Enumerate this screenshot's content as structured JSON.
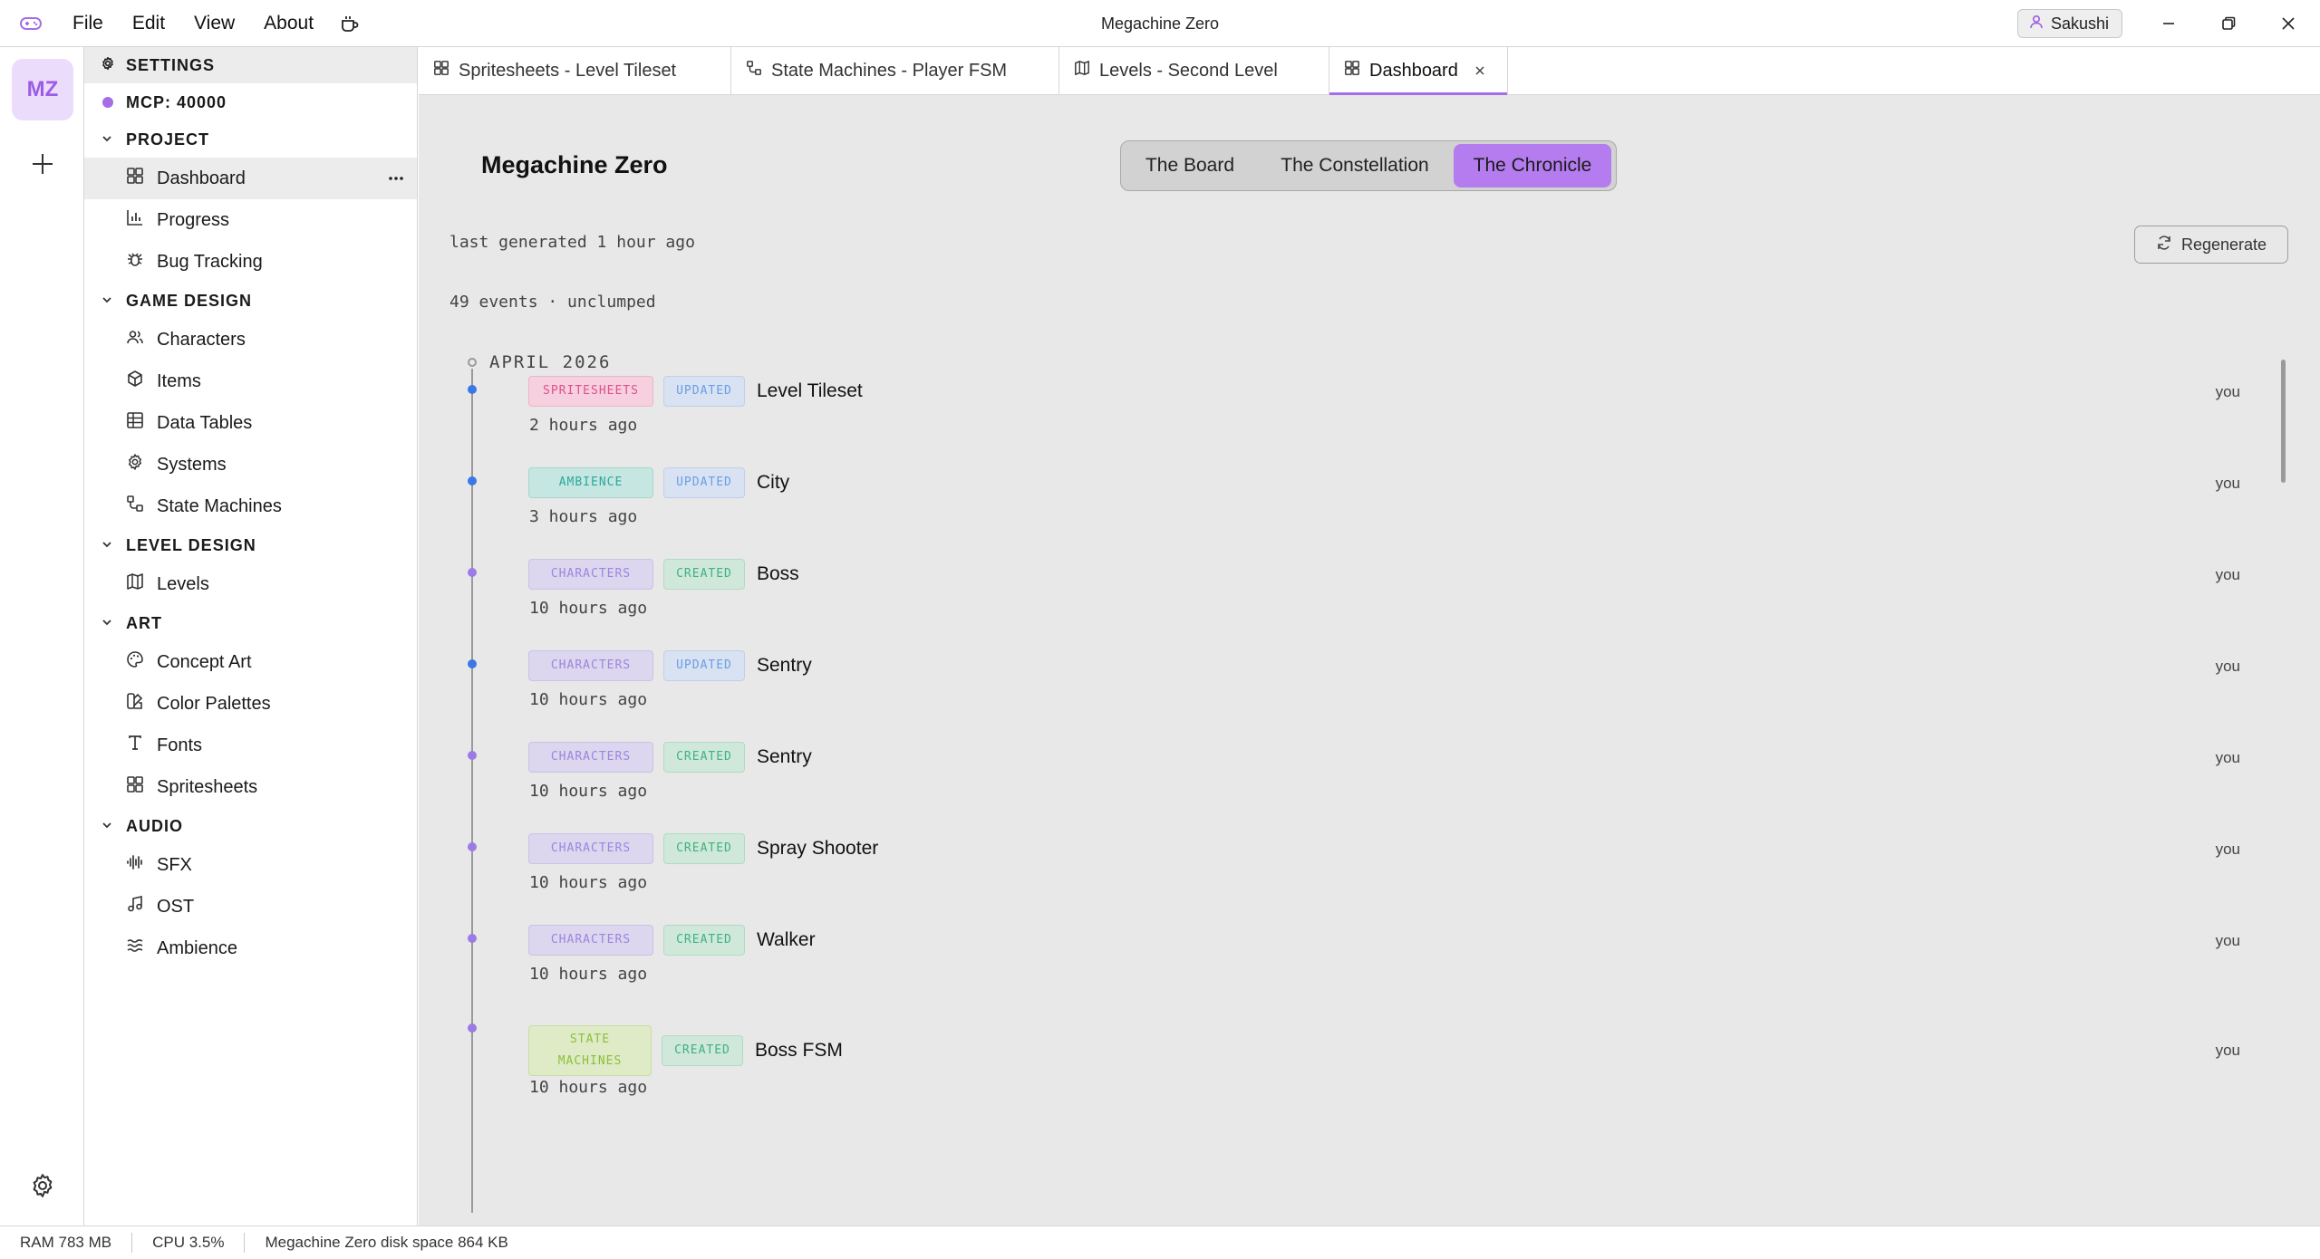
{
  "window": {
    "title": "Megachine Zero"
  },
  "menu": [
    "File",
    "Edit",
    "View",
    "About"
  ],
  "user": {
    "name": "Sakushi"
  },
  "rail": {
    "avatar": "MZ"
  },
  "sidebar": {
    "settings_label": "SETTINGS",
    "mcp_label": "MCP: 40000",
    "sections": [
      {
        "label": "PROJECT",
        "items": [
          {
            "label": "Dashboard",
            "icon": "grid-icon",
            "active": true
          },
          {
            "label": "Progress",
            "icon": "bar-chart-icon"
          },
          {
            "label": "Bug Tracking",
            "icon": "bug-icon"
          }
        ]
      },
      {
        "label": "GAME DESIGN",
        "items": [
          {
            "label": "Characters",
            "icon": "users-icon"
          },
          {
            "label": "Items",
            "icon": "box-icon"
          },
          {
            "label": "Data Tables",
            "icon": "table-icon"
          },
          {
            "label": "Systems",
            "icon": "cog-icon"
          },
          {
            "label": "State Machines",
            "icon": "workflow-icon"
          }
        ]
      },
      {
        "label": "LEVEL DESIGN",
        "items": [
          {
            "label": "Levels",
            "icon": "map-icon"
          }
        ]
      },
      {
        "label": "ART",
        "items": [
          {
            "label": "Concept Art",
            "icon": "palette-icon"
          },
          {
            "label": "Color Palettes",
            "icon": "swatch-icon"
          },
          {
            "label": "Fonts",
            "icon": "type-icon"
          },
          {
            "label": "Spritesheets",
            "icon": "grid-icon"
          }
        ]
      },
      {
        "label": "AUDIO",
        "items": [
          {
            "label": "SFX",
            "icon": "waveform-icon"
          },
          {
            "label": "OST",
            "icon": "music-icon"
          },
          {
            "label": "Ambience",
            "icon": "waves-icon"
          }
        ]
      }
    ]
  },
  "tabs": [
    {
      "label": "Spritesheets - Level Tileset",
      "icon": "grid-icon"
    },
    {
      "label": "State Machines - Player FSM",
      "icon": "workflow-icon"
    },
    {
      "label": "Levels - Second Level",
      "icon": "map-icon"
    },
    {
      "label": "Dashboard",
      "icon": "grid-icon",
      "active": true
    }
  ],
  "main": {
    "project_title": "Megachine Zero",
    "views": [
      {
        "label": "The Board"
      },
      {
        "label": "The Constellation"
      },
      {
        "label": "The Chronicle",
        "active": true
      }
    ],
    "last_generated": "last generated 1 hour ago",
    "regenerate_label": "Regenerate",
    "events_summary": "49 events · unclumped",
    "month": "APRIL 2026",
    "events": [
      {
        "category": "SPRITESHEETS",
        "action": "UPDATED",
        "name": "Level Tileset",
        "time": "2 hours ago",
        "who": "you"
      },
      {
        "category": "AMBIENCE",
        "action": "UPDATED",
        "name": "City",
        "time": "3 hours ago",
        "who": "you"
      },
      {
        "category": "CHARACTERS",
        "action": "CREATED",
        "name": "Boss",
        "time": "10 hours ago",
        "who": "you"
      },
      {
        "category": "CHARACTERS",
        "action": "UPDATED",
        "name": "Sentry",
        "time": "10 hours ago",
        "who": "you"
      },
      {
        "category": "CHARACTERS",
        "action": "CREATED",
        "name": "Sentry",
        "time": "10 hours ago",
        "who": "you"
      },
      {
        "category": "CHARACTERS",
        "action": "CREATED",
        "name": "Spray Shooter",
        "time": "10 hours ago",
        "who": "you"
      },
      {
        "category": "CHARACTERS",
        "action": "CREATED",
        "name": "Walker",
        "time": "10 hours ago",
        "who": "you"
      },
      {
        "category": "STATE MACHINES",
        "action": "CREATED",
        "name": "Boss FSM",
        "time": "10 hours ago",
        "who": "you"
      }
    ]
  },
  "colors": {
    "accent": "#b57cf0",
    "spritesheets": "#e0508a",
    "ambience": "#2aa89a",
    "characters": "#9b86e0",
    "state_machines": "#8cbf3a",
    "updated": "#6a9ee6",
    "created": "#3fb27f"
  },
  "statusbar": {
    "ram": "RAM 783 MB",
    "cpu": "CPU 3.5%",
    "disk": "Megachine Zero disk space 864 KB"
  }
}
